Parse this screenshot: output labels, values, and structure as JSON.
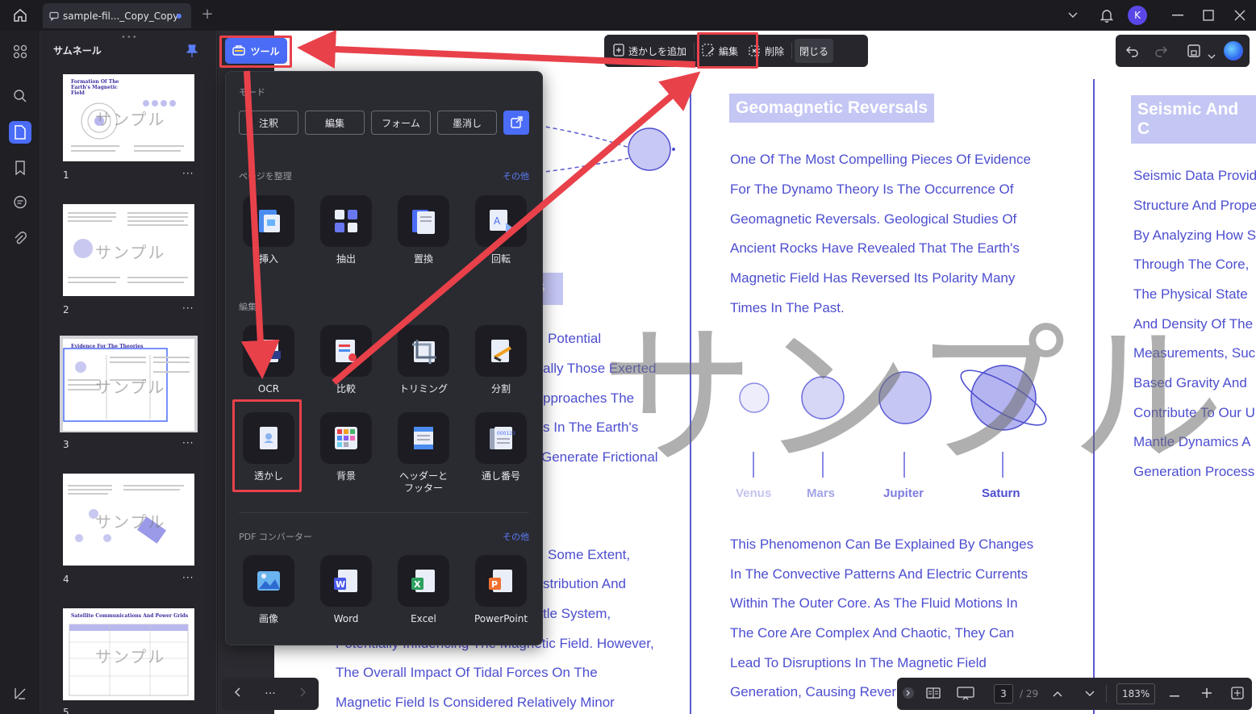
{
  "titlebar": {
    "tab_title": "sample-fil..._Copy_Copy",
    "avatar_letter": "K"
  },
  "thumbnails": {
    "header": "サムネール",
    "pages": [
      {
        "number": "1",
        "title": "Formation Of The Earth's Magnetic Field",
        "watermark": "サンプル"
      },
      {
        "number": "2",
        "title": "",
        "watermark": "サンプル"
      },
      {
        "number": "3",
        "title": "Evidence For The Theories",
        "watermark": "サンプル"
      },
      {
        "number": "4",
        "title": "",
        "watermark": "サンプル"
      },
      {
        "number": "5",
        "title": "Satellite Communications And Power Grids",
        "watermark": "サンプル"
      }
    ],
    "more": "···"
  },
  "tool_button": {
    "label": "ツール"
  },
  "watermark_toolbar": {
    "add": "透かしを追加",
    "edit": "編集",
    "delete": "削除",
    "close": "閉じる"
  },
  "popup": {
    "mode_title": "モード",
    "modes": [
      "注釈",
      "編集",
      "フォーム",
      "墨消し"
    ],
    "organize_title": "ページを整理",
    "organize_more": "その他",
    "organize_items": [
      "挿入",
      "抽出",
      "置換",
      "回転"
    ],
    "edit_title": "編集",
    "edit_items": [
      "OCR",
      "比較",
      "トリミング",
      "分割",
      "透かし",
      "背景",
      "ヘッダーと\nフッター",
      "通し番号"
    ],
    "converter_title": "PDF コンバーター",
    "converter_more": "その他",
    "converter_items": [
      "画像",
      "Word",
      "Excel",
      "PowerPoint"
    ]
  },
  "document": {
    "middle_heading": "Geomagnetic Reversals",
    "right_heading": "Seismic And C",
    "middle_paragraph_1": [
      "One Of The Most Compelling Pieces Of Evidence",
      "For The Dynamo Theory Is The Occurrence Of",
      "Geomagnetic Reversals. Geological Studies Of",
      "Ancient Rocks Have Revealed That The Earth's",
      "Magnetic Field Has Reversed Its Polarity Many",
      "Times In The Past."
    ],
    "middle_paragraph_2": [
      "This Phenomenon Can Be Explained By Changes",
      "In The Convective Patterns And Electric Currents",
      "Within The Outer Core. As The Fluid Motions In",
      "The Core Are Complex And Chaotic, They Can",
      "Lead To Disruptions In The Magnetic Field",
      "Generation, Causing Rever"
    ],
    "left_column_upper": [
      "Potential",
      "ally Those Exerted",
      "pproaches The",
      "s In The Earth's",
      "Generate Frictional"
    ],
    "left_column_lower": [
      "Some Extent,",
      "stribution And",
      "tle System,",
      "Potentially Influencing The Magnetic Field. However,",
      "The Overall Impact Of Tidal Forces On The",
      "Magnetic Field Is Considered Relatively Minor"
    ],
    "left_fragment_heading": "s",
    "right_column": [
      "Seismic Data Provid",
      "Structure And Prope",
      "By Analyzing How S",
      "Through The Core,",
      "The Physical State",
      "And Density Of The",
      "Measurements, Suc",
      "Based Gravity And",
      "Contribute To Our U",
      "Mantle Dynamics A",
      "Generation Process"
    ],
    "planets": [
      "Venus",
      "Mars",
      "Jupiter",
      "Saturn"
    ],
    "watermark_text": "サンプル"
  },
  "bottom_bar": {
    "current_page": "3",
    "total_pages": "/ 29",
    "zoom": "183%"
  },
  "colors": {
    "accent": "#4a6cf7",
    "annotation_red": "#e8414a",
    "doc_text": "#4d4ed0"
  }
}
